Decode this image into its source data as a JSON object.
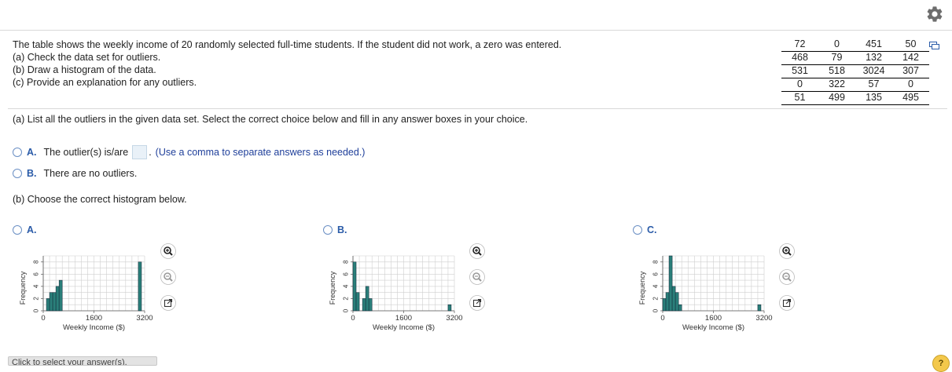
{
  "header": {
    "settings_icon": "gear-icon"
  },
  "question": {
    "lines": [
      "The table shows the weekly income of 20 randomly selected full-time students. If the student did not work, a zero was entered.",
      "(a) Check the data set for outliers.",
      "(b) Draw a histogram of the data.",
      "(c) Provide an explanation for any outliers."
    ]
  },
  "dataset": {
    "rows": [
      [
        "72",
        "0",
        "451",
        "50"
      ],
      [
        "468",
        "79",
        "132",
        "142"
      ],
      [
        "531",
        "518",
        "3024",
        "307"
      ],
      [
        "0",
        "322",
        "57",
        "0"
      ],
      [
        "51",
        "499",
        "135",
        "495"
      ]
    ],
    "copy_icon": "copy-icon"
  },
  "part_a": {
    "prompt": "(a) List all the outliers in the given data set. Select the correct choice below and fill in any answer boxes in your choice.",
    "choice_a": {
      "letter": "A.",
      "text": "The outlier(s) is/are",
      "after": ".",
      "hint": "(Use a comma to separate answers as needed.)",
      "value": ""
    },
    "choice_b": {
      "letter": "B.",
      "text": "There are no outliers."
    }
  },
  "part_b": {
    "prompt": "(b) Choose the correct histogram below.",
    "options": [
      {
        "letter": "A.",
        "ylabel": "Frequency",
        "xlabel": "Weekly Income ($)",
        "xticks": [
          "0",
          "1600",
          "3200"
        ],
        "yticks": [
          "0",
          "2",
          "4",
          "6",
          "8"
        ]
      },
      {
        "letter": "B.",
        "ylabel": "Frequency",
        "xlabel": "Weekly Income ($)",
        "xticks": [
          "0",
          "1600",
          "3200"
        ],
        "yticks": [
          "0",
          "2",
          "4",
          "6",
          "8"
        ]
      },
      {
        "letter": "C.",
        "ylabel": "Frequency",
        "xlabel": "Weekly Income ($)",
        "xticks": [
          "0",
          "1600",
          "3200"
        ],
        "yticks": [
          "0",
          "2",
          "4",
          "6",
          "8"
        ]
      }
    ],
    "tool_icons": [
      "zoom-in-icon",
      "zoom-out-icon",
      "enlarge-icon"
    ]
  },
  "chart_data": [
    {
      "type": "bar",
      "bin_width": 100,
      "xlim": [
        0,
        3200
      ],
      "ylim": [
        0,
        9
      ],
      "x": [
        100,
        200,
        300,
        400,
        500,
        3000
      ],
      "values": [
        2,
        3,
        3,
        4,
        5,
        8
      ]
    },
    {
      "type": "bar",
      "bin_width": 100,
      "xlim": [
        0,
        3200
      ],
      "ylim": [
        0,
        9
      ],
      "x": [
        0,
        100,
        300,
        400,
        500,
        3000
      ],
      "values": [
        8,
        3,
        2,
        4,
        2,
        1
      ]
    },
    {
      "type": "bar",
      "bin_width": 100,
      "xlim": [
        0,
        3200
      ],
      "ylim": [
        0,
        9
      ],
      "x": [
        0,
        100,
        200,
        300,
        400,
        500,
        3000
      ],
      "values": [
        2,
        3,
        9,
        4,
        3,
        1,
        1
      ]
    }
  ],
  "footer": {
    "select_label": "Click to select your answer(s).",
    "help_label": "?"
  },
  "colors": {
    "bar": "#2a7f7a",
    "accent": "#2a5ba8"
  }
}
